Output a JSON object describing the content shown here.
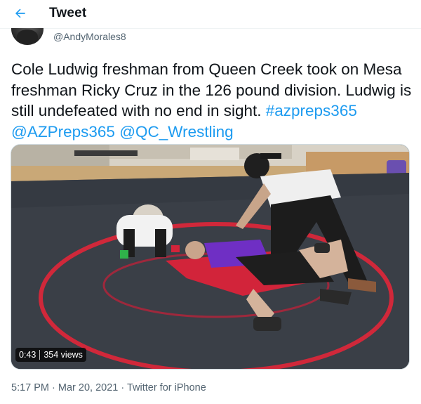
{
  "header": {
    "title": "Tweet",
    "back_icon": "arrow-left-icon",
    "accent": "#1d9bf0"
  },
  "tweet": {
    "handle": "@AndyMorales8",
    "text_plain": "Cole Ludwig freshman from Queen Creek took on Mesa freshman Ricky Cruz in the 126 pound division. Ludwig is still undefeated with no end in sight.",
    "hashtag": "#azpreps365",
    "mentions": [
      "@AZPreps365",
      "@QC_Wrestling"
    ],
    "video": {
      "duration": "0:43",
      "views": "354 views"
    },
    "meta": "5:17 PM · Mar 20, 2021 · Twitter for iPhone"
  }
}
